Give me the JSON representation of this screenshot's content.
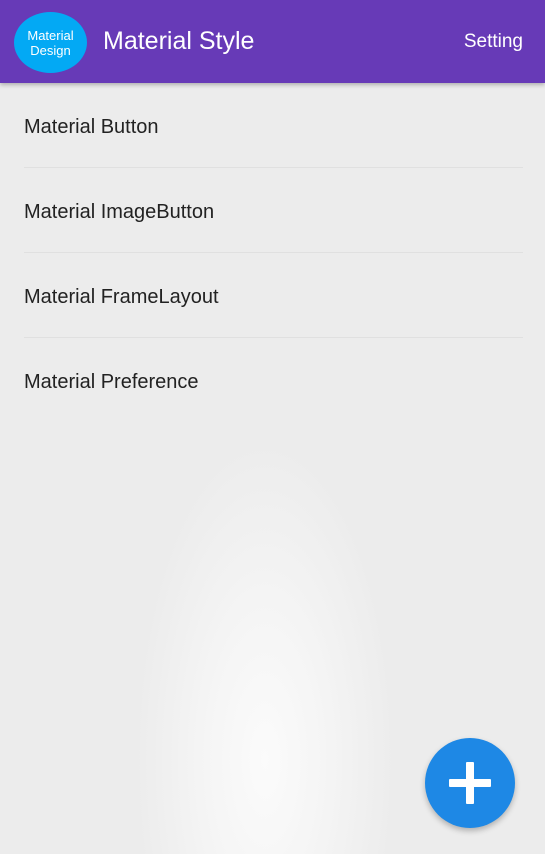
{
  "appbar": {
    "logo_line1": "Material",
    "logo_line2": "Design",
    "title": "Material Style",
    "action_label": "Setting",
    "color": "#673ab7",
    "logo_color": "#03a9f4"
  },
  "list": {
    "items": [
      {
        "label": "Material Button"
      },
      {
        "label": "Material ImageButton"
      },
      {
        "label": "Material FrameLayout"
      },
      {
        "label": "Material Preference"
      }
    ]
  },
  "fab": {
    "icon": "plus-icon",
    "color": "#1e88e5"
  }
}
